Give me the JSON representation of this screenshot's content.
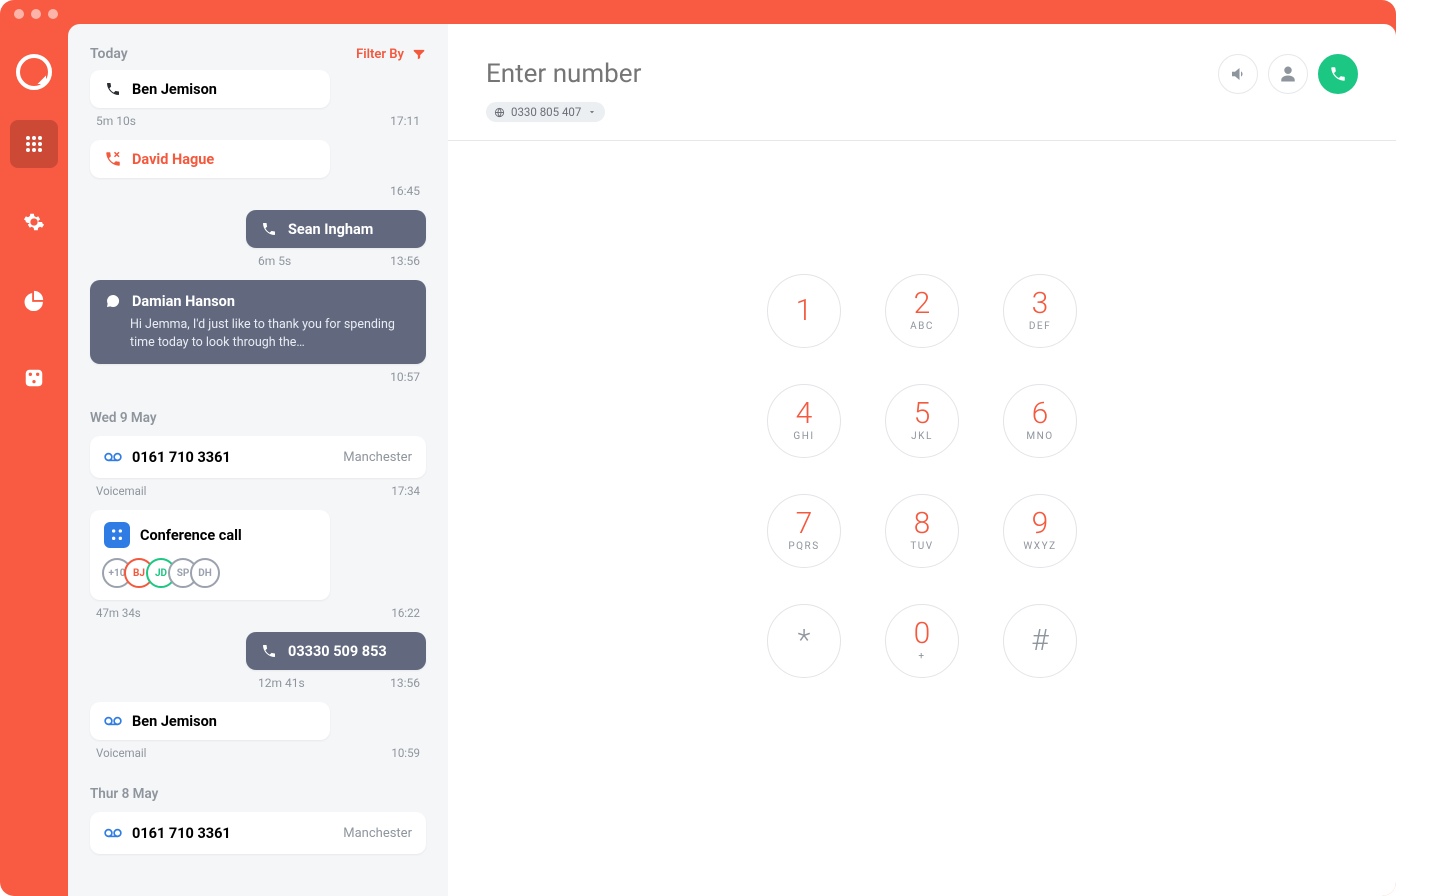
{
  "colors": {
    "coral": "#F4593E",
    "slate": "#62697F",
    "green": "#1CC783",
    "blue": "#2F7DE4"
  },
  "dialer": {
    "placeholder": "Enter number",
    "callingNumber": "0330 805 407",
    "keys": [
      {
        "d": "1",
        "l": ""
      },
      {
        "d": "2",
        "l": "ABC"
      },
      {
        "d": "3",
        "l": "DEF"
      },
      {
        "d": "4",
        "l": "GHI"
      },
      {
        "d": "5",
        "l": "JKL"
      },
      {
        "d": "6",
        "l": "MNO"
      },
      {
        "d": "7",
        "l": "PQRS"
      },
      {
        "d": "8",
        "l": "TUV"
      },
      {
        "d": "9",
        "l": "WXYZ"
      },
      {
        "d": "*",
        "l": "",
        "grey": true
      },
      {
        "d": "0",
        "l": "+"
      },
      {
        "d": "#",
        "l": "",
        "grey": true
      }
    ]
  },
  "log": {
    "filterLabel": "Filter By",
    "sections": [
      {
        "title": "Today",
        "entries": [
          {
            "kind": "in",
            "name": "Ben Jemison",
            "dur": "5m 10s",
            "time": "17:11"
          },
          {
            "kind": "missed",
            "name": "David Hague",
            "time": "16:45"
          },
          {
            "kind": "out",
            "name": "Sean Ingham",
            "dur": "6m 5s",
            "time": "13:56"
          },
          {
            "kind": "msg",
            "name": "Damian Hanson",
            "body": "Hi Jemma, I'd just like to thank you for spending time today to look through the…",
            "time": "10:57"
          }
        ]
      },
      {
        "title": "Wed 9 May",
        "entries": [
          {
            "kind": "vm",
            "name": "0161 710 3361",
            "loc": "Manchester",
            "label": "Voicemail",
            "time": "17:34"
          },
          {
            "kind": "conf",
            "name": "Conference call",
            "avatars": [
              "+10",
              "BJ",
              "JD",
              "SP",
              "DH"
            ],
            "dur": "47m 34s",
            "time": "16:22"
          },
          {
            "kind": "out",
            "name": "03330 509 853",
            "dur": "12m 41s",
            "time": "13:56",
            "numeric": true
          },
          {
            "kind": "vm2",
            "name": "Ben Jemison",
            "label": "Voicemail",
            "time": "10:59"
          }
        ]
      },
      {
        "title": "Thur 8 May",
        "entries": [
          {
            "kind": "vm",
            "name": "0161 710 3361",
            "loc": "Manchester"
          }
        ]
      }
    ]
  }
}
